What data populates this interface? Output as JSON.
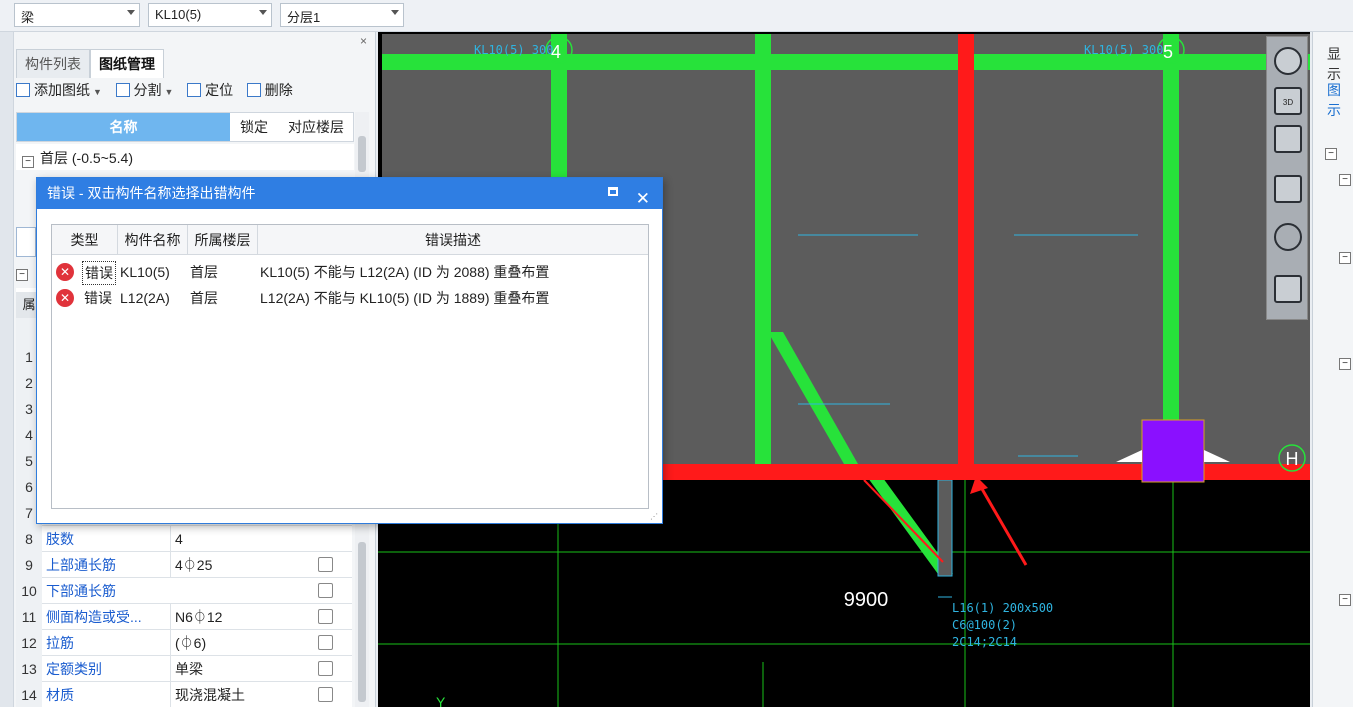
{
  "toolbar": {
    "combo1_value": "梁",
    "combo2_value": "KL10(5)",
    "combo3_value": "分层1"
  },
  "left_panel": {
    "close_label": "×",
    "tabs": [
      "构件列表",
      "图纸管理"
    ],
    "buttons": {
      "add_drawing": "添加图纸",
      "split": "分割",
      "locate": "定位",
      "delete": "删除"
    },
    "tree_header": {
      "name": "名称",
      "lock": "锁定",
      "floor": "对应楼层"
    },
    "tree_row": "首层 (-0.5~5.4)",
    "row_numbers_visible": [
      "1",
      "2",
      "3",
      "4",
      "5",
      "6",
      "7"
    ],
    "props": [
      {
        "num": "8",
        "name": "肢数",
        "value": "4"
      },
      {
        "num": "9",
        "name": "上部通长筋",
        "value": "4⏀25"
      },
      {
        "num": "10",
        "name": "下部通长筋",
        "value": ""
      },
      {
        "num": "11",
        "name": "侧面构造或受...",
        "value": "N6⏀12"
      },
      {
        "num": "12",
        "name": "拉筋",
        "value": "(⏀6)"
      },
      {
        "num": "13",
        "name": "定额类别",
        "value": "单梁"
      },
      {
        "num": "14",
        "name": "材质",
        "value": "现浇混凝土"
      }
    ]
  },
  "dialog": {
    "title": "错误 - 双击构件名称选择出错构件",
    "columns": [
      "类型",
      "构件名称",
      "所属楼层",
      "错误描述"
    ],
    "rows": [
      {
        "type": "错误",
        "name": "KL10(5)",
        "floor": "首层",
        "desc": "KL10(5) 不能与 L12(2A) (ID 为 2088) 重叠布置"
      },
      {
        "type": "错误",
        "name": "L12(2A)",
        "floor": "首层",
        "desc": "L12(2A) 不能与 KL10(5) (ID 为 1889) 重叠布置"
      }
    ]
  },
  "canvas": {
    "axis_labels": [
      "4",
      "5",
      "H"
    ],
    "dimension": "9900",
    "beam_note": [
      "L16(1) 200x500",
      "C6@100(2)",
      "2C14;2C14"
    ],
    "y_label": "Y",
    "colors": {
      "green_beam": "#27e23a",
      "red_beam": "#ff1a1a",
      "slab": "#5c5c5c",
      "column": "#8a10ff",
      "grid": "#19c019"
    }
  },
  "right_panel": {
    "tab": "显示",
    "tab2": "图示"
  },
  "viewcube": {
    "icons": [
      "orbit-icon",
      "3d-view-icon",
      "cube-top-icon",
      "cube-front-icon",
      "rotate-icon",
      "grid-select-icon"
    ]
  }
}
